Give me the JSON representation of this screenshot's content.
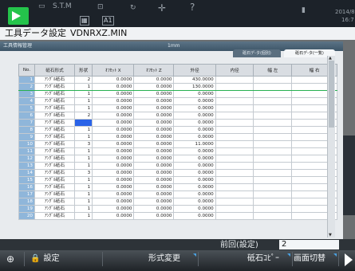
{
  "colors": {
    "accent_green": "#24c44b",
    "cursor_blue": "#2a63e8",
    "header_bar": "#3d5567"
  },
  "topbar": {
    "s1": "S.T.M",
    "s2": "A1",
    "date": "2014/8",
    "time": "16:7"
  },
  "title": {
    "screen": "工具データ設定",
    "file": "VDNRXZ.MIN"
  },
  "panel": {
    "heading": "工具情報管理",
    "unit": "1mm",
    "tabs": [
      "砥石デ-タ(個別)",
      "砥石デ-タ(一覧)"
    ],
    "columns": [
      "No.",
      "砥石形式",
      "形状",
      "ｵﾌｾｯﾄ X",
      "ｵﾌｾｯﾄ Z",
      "外径",
      "内径",
      "幅 左",
      "幅 右"
    ],
    "rows": [
      {
        "no": "1",
        "type": "ｱﾝｸﾞﾙ砥石",
        "shape": "2",
        "ox": "0.0000",
        "oz": "0.0000",
        "od": "430.0000"
      },
      {
        "no": "2",
        "type": "ｱﾝｸﾞﾙ砥石",
        "shape": "1",
        "ox": "0.0000",
        "oz": "0.0000",
        "od": "130.0000"
      },
      {
        "no": "3",
        "type": "ｱﾝｸﾞﾙ砥石",
        "shape": "1",
        "ox": "0.0000",
        "oz": "0.0000",
        "od": "0.0000"
      },
      {
        "no": "4",
        "type": "ｱﾝｸﾞﾙ砥石",
        "shape": "1",
        "ox": "0.0000",
        "oz": "0.0000",
        "od": "0.0000"
      },
      {
        "no": "5",
        "type": "ｱﾝｸﾞﾙ砥石",
        "shape": "1",
        "ox": "0.0000",
        "oz": "0.0000",
        "od": "0.0000"
      },
      {
        "no": "6",
        "type": "ｱﾝｸﾞﾙ砥石",
        "shape": "2",
        "ox": "0.0000",
        "oz": "0.0000",
        "od": "0.0000"
      },
      {
        "no": "7",
        "type": "ｱﾝｸﾞﾙ砥石",
        "shape": "",
        "ox": "0.0000",
        "oz": "0.0000",
        "od": "0.0000"
      },
      {
        "no": "8",
        "type": "ｱﾝｸﾞﾙ砥石",
        "shape": "1",
        "ox": "0.0000",
        "oz": "0.0000",
        "od": "0.0000"
      },
      {
        "no": "9",
        "type": "ｱﾝｸﾞﾙ砥石",
        "shape": "1",
        "ox": "0.0000",
        "oz": "0.0000",
        "od": "0.0000"
      },
      {
        "no": "10",
        "type": "ｱﾝｸﾞﾙ砥石",
        "shape": "3",
        "ox": "0.0000",
        "oz": "0.0000",
        "od": "11.0000"
      },
      {
        "no": "11",
        "type": "ｱﾝｸﾞﾙ砥石",
        "shape": "1",
        "ox": "0.0000",
        "oz": "0.0000",
        "od": "0.0000"
      },
      {
        "no": "12",
        "type": "ｱﾝｸﾞﾙ砥石",
        "shape": "1",
        "ox": "0.0000",
        "oz": "0.0000",
        "od": "0.0000"
      },
      {
        "no": "13",
        "type": "ｱﾝｸﾞﾙ砥石",
        "shape": "1",
        "ox": "0.0000",
        "oz": "0.0000",
        "od": "0.0000"
      },
      {
        "no": "14",
        "type": "ｱﾝｸﾞﾙ砥石",
        "shape": "3",
        "ox": "0.0000",
        "oz": "0.0000",
        "od": "0.0000"
      },
      {
        "no": "15",
        "type": "ｱﾝｸﾞﾙ砥石",
        "shape": "1",
        "ox": "0.0000",
        "oz": "0.0000",
        "od": "0.0000"
      },
      {
        "no": "16",
        "type": "ｱﾝｸﾞﾙ砥石",
        "shape": "1",
        "ox": "0.0000",
        "oz": "0.0000",
        "od": "0.0000"
      },
      {
        "no": "17",
        "type": "ｱﾝｸﾞﾙ砥石",
        "shape": "1",
        "ox": "0.0000",
        "oz": "0.0000",
        "od": "0.0000"
      },
      {
        "no": "18",
        "type": "ｱﾝｸﾞﾙ砥石",
        "shape": "1",
        "ox": "0.0000",
        "oz": "0.0000",
        "od": "0.0000"
      },
      {
        "no": "19",
        "type": "ｱﾝｸﾞﾙ砥石",
        "shape": "1",
        "ox": "0.0000",
        "oz": "0.0000",
        "od": "0.0000"
      },
      {
        "no": "20",
        "type": "ｱﾝｸﾞﾙ砥石",
        "shape": "1",
        "ox": "0.0000",
        "oz": "0.0000",
        "od": "0.0000"
      }
    ]
  },
  "status": {
    "label": "前回(設定)",
    "value": "2"
  },
  "softkeys": {
    "k1": "設定",
    "k2": "形式変更",
    "k3": "砥石ｺﾋﾟｰ",
    "k4": "画面切替"
  }
}
